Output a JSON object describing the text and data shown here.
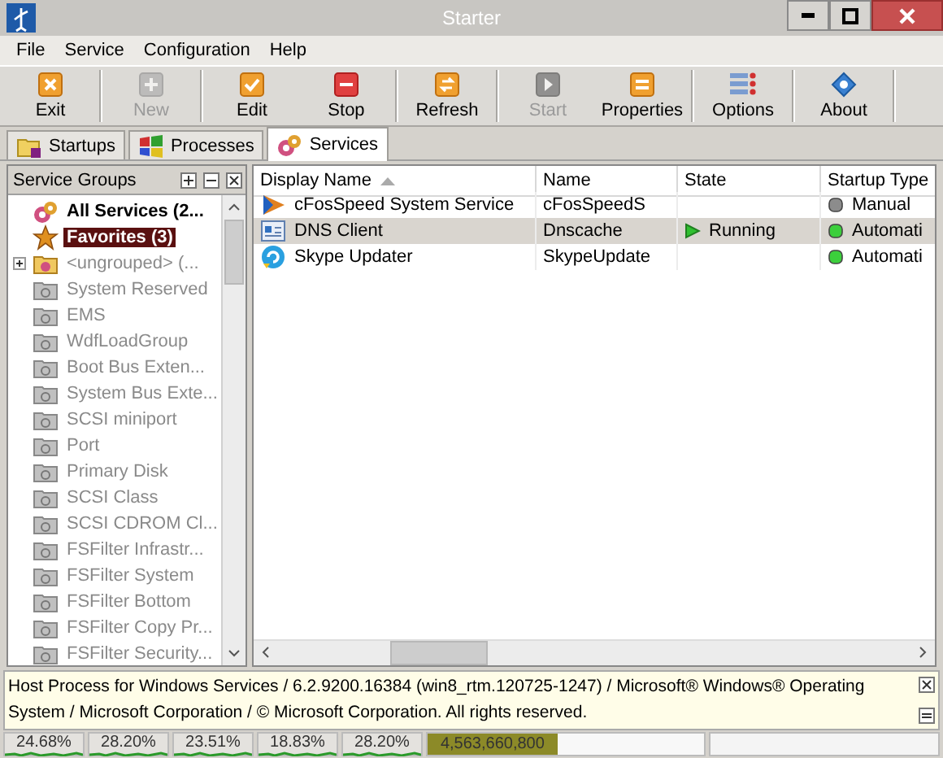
{
  "window": {
    "title": "Starter"
  },
  "menu": [
    "File",
    "Service",
    "Configuration",
    "Help"
  ],
  "toolbar": [
    {
      "label": "Exit",
      "kind": "exit",
      "disabled": false,
      "group_end": true
    },
    {
      "label": "New",
      "kind": "new",
      "disabled": true,
      "group_end": true
    },
    {
      "label": "Edit",
      "kind": "edit",
      "disabled": false,
      "group_end": false
    },
    {
      "label": "Stop",
      "kind": "stop",
      "disabled": false,
      "group_end": true
    },
    {
      "label": "Refresh",
      "kind": "refresh",
      "disabled": false,
      "group_end": true
    },
    {
      "label": "Start",
      "kind": "start",
      "disabled": true,
      "group_end": false
    },
    {
      "label": "Properties",
      "kind": "properties",
      "disabled": false,
      "group_end": true
    },
    {
      "label": "Options",
      "kind": "options",
      "disabled": false,
      "group_end": true
    },
    {
      "label": "About",
      "kind": "about",
      "disabled": false,
      "group_end": true
    }
  ],
  "tabs": [
    {
      "label": "Startups",
      "kind": "startups",
      "selected": false
    },
    {
      "label": "Processes",
      "kind": "processes",
      "selected": false
    },
    {
      "label": "Services",
      "kind": "services",
      "selected": true
    }
  ],
  "sidebar": {
    "title": "Service Groups",
    "items": [
      {
        "label": "All Services (2...",
        "kind": "all",
        "bold": true,
        "selected": false,
        "expandable": false
      },
      {
        "label": "Favorites (3)",
        "kind": "favorites",
        "bold": true,
        "selected": true,
        "expandable": false
      },
      {
        "label": "<ungrouped> (...",
        "kind": "ungrouped",
        "bold": false,
        "selected": false,
        "expandable": true
      },
      {
        "label": "System Reserved",
        "kind": "group",
        "bold": false,
        "selected": false,
        "expandable": false
      },
      {
        "label": "EMS",
        "kind": "group",
        "bold": false,
        "selected": false,
        "expandable": false
      },
      {
        "label": "WdfLoadGroup",
        "kind": "group",
        "bold": false,
        "selected": false,
        "expandable": false
      },
      {
        "label": "Boot Bus Exten...",
        "kind": "group",
        "bold": false,
        "selected": false,
        "expandable": false
      },
      {
        "label": "System Bus Exte...",
        "kind": "group",
        "bold": false,
        "selected": false,
        "expandable": false
      },
      {
        "label": "SCSI miniport",
        "kind": "group",
        "bold": false,
        "selected": false,
        "expandable": false
      },
      {
        "label": "Port",
        "kind": "group",
        "bold": false,
        "selected": false,
        "expandable": false
      },
      {
        "label": "Primary Disk",
        "kind": "group",
        "bold": false,
        "selected": false,
        "expandable": false
      },
      {
        "label": "SCSI Class",
        "kind": "group",
        "bold": false,
        "selected": false,
        "expandable": false
      },
      {
        "label": "SCSI CDROM Cl...",
        "kind": "group",
        "bold": false,
        "selected": false,
        "expandable": false
      },
      {
        "label": "FSFilter Infrastr...",
        "kind": "group",
        "bold": false,
        "selected": false,
        "expandable": false
      },
      {
        "label": "FSFilter System",
        "kind": "group",
        "bold": false,
        "selected": false,
        "expandable": false
      },
      {
        "label": "FSFilter Bottom",
        "kind": "group",
        "bold": false,
        "selected": false,
        "expandable": false
      },
      {
        "label": "FSFilter Copy Pr...",
        "kind": "group",
        "bold": false,
        "selected": false,
        "expandable": false
      },
      {
        "label": "FSFilter Security...",
        "kind": "group",
        "bold": false,
        "selected": false,
        "expandable": false
      }
    ]
  },
  "table": {
    "columns": [
      {
        "label": "Display Name",
        "sorted": true
      },
      {
        "label": "Name",
        "sorted": false
      },
      {
        "label": "State",
        "sorted": false
      },
      {
        "label": "Startup Type",
        "sorted": false
      }
    ],
    "rows": [
      {
        "display_name": "cFosSpeed System Service",
        "kind": "speed",
        "name": "cFosSpeedS",
        "state": "",
        "startup": "Manual",
        "color": "#8c8c8c",
        "selected": false
      },
      {
        "display_name": "DNS Client",
        "kind": "dns",
        "name": "Dnscache",
        "state": "Running",
        "startup": "Automati",
        "color": "#3ccf3c",
        "selected": true
      },
      {
        "display_name": "Skype Updater",
        "kind": "updater",
        "name": "SkypeUpdate",
        "state": "",
        "startup": "Automati",
        "color": "#3ccf3c",
        "selected": false
      }
    ]
  },
  "info_text": "Host Process for Windows Services / 6.2.9200.16384 (win8_rtm.120725-1247) / Microsoft® Windows® Operating System / Microsoft Corporation / © Microsoft Corporation. All rights reserved.",
  "status_bar": {
    "meters": [
      "24.68%",
      "28.20%",
      "23.51%",
      "18.83%",
      "28.20%"
    ],
    "memory": {
      "label": "4,563,660,800",
      "level": 0.47
    }
  }
}
